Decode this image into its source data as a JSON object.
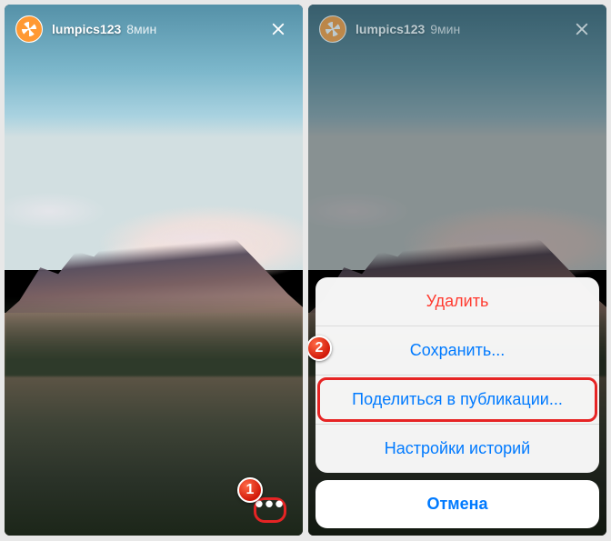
{
  "left": {
    "username": "lumpics123",
    "time_ago": "8мин"
  },
  "right": {
    "username": "lumpics123",
    "time_ago": "9мин",
    "sheet": {
      "delete": "Удалить",
      "save": "Сохранить...",
      "share_post": "Поделиться в публикации...",
      "story_settings": "Настройки историй",
      "cancel": "Отмена"
    }
  },
  "annotations": {
    "step1": "1",
    "step2": "2"
  }
}
